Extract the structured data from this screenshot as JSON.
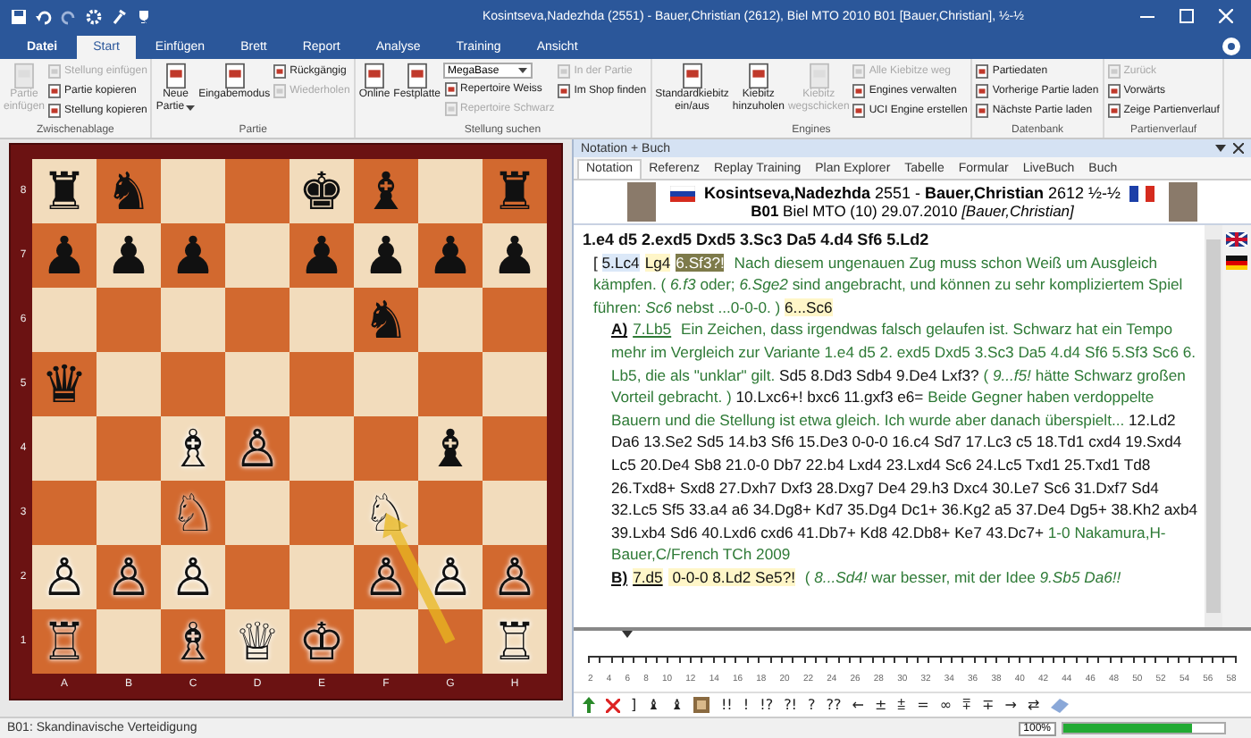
{
  "window": {
    "title": "Kosintseva,Nadezhda (2551) - Bauer,Christian (2612), Biel MTO 2010  B01  [Bauer,Christian], ½-½"
  },
  "tabs": [
    {
      "label": "Datei",
      "selected": false
    },
    {
      "label": "Start",
      "selected": true
    },
    {
      "label": "Einfügen",
      "selected": false
    },
    {
      "label": "Brett",
      "selected": false
    },
    {
      "label": "Report",
      "selected": false
    },
    {
      "label": "Analyse",
      "selected": false
    },
    {
      "label": "Training",
      "selected": false
    },
    {
      "label": "Ansicht",
      "selected": false
    }
  ],
  "ribbon": [
    {
      "label": "Zwischenablage",
      "columns": [
        {
          "kind": "large",
          "lines": [
            "Partie",
            "einfügen"
          ],
          "disabled": true
        },
        {
          "kind": "stack",
          "items": [
            {
              "label": "Stellung einfügen",
              "disabled": true
            },
            {
              "label": "Partie kopieren",
              "disabled": false
            },
            {
              "label": "Stellung kopieren",
              "disabled": false
            }
          ]
        }
      ]
    },
    {
      "label": "Partie",
      "columns": [
        {
          "kind": "large",
          "lines": [
            "Neue",
            "Partie"
          ],
          "disabled": false,
          "dropdown": true
        },
        {
          "kind": "large",
          "lines": [
            "Eingabemodus"
          ],
          "disabled": false
        },
        {
          "kind": "stack",
          "items": [
            {
              "label": "Rückgängig",
              "disabled": false
            },
            {
              "label": "Wiederholen",
              "disabled": true
            }
          ]
        }
      ]
    },
    {
      "label": "Stellung suchen",
      "columns": [
        {
          "kind": "large",
          "lines": [
            "Online"
          ],
          "disabled": false
        },
        {
          "kind": "large",
          "lines": [
            "Festplatte"
          ],
          "disabled": false
        },
        {
          "kind": "stack",
          "items": [
            {
              "label": "MegaBase",
              "disabled": false,
              "combo": true
            },
            {
              "label": "Repertoire Weiss",
              "disabled": false
            },
            {
              "label": "Repertoire Schwarz",
              "disabled": true
            }
          ]
        },
        {
          "kind": "stack",
          "items": [
            {
              "label": "In der Partie",
              "disabled": true
            },
            {
              "label": "Im Shop finden",
              "disabled": false
            }
          ]
        }
      ]
    },
    {
      "label": "Engines",
      "columns": [
        {
          "kind": "large",
          "lines": [
            "Standardkiebitz",
            "ein/aus"
          ],
          "disabled": false
        },
        {
          "kind": "large",
          "lines": [
            "Kiebitz",
            "hinzuholen"
          ],
          "disabled": false
        },
        {
          "kind": "large",
          "lines": [
            "Kiebitz",
            "wegschicken"
          ],
          "disabled": true
        },
        {
          "kind": "stack",
          "items": [
            {
              "label": "Alle Kiebitze weg",
              "disabled": true
            },
            {
              "label": "Engines verwalten",
              "disabled": false
            },
            {
              "label": "UCI Engine erstellen",
              "disabled": false
            }
          ]
        }
      ]
    },
    {
      "label": "Datenbank",
      "columns": [
        {
          "kind": "stack",
          "items": [
            {
              "label": "Partiedaten",
              "disabled": false
            },
            {
              "label": "Vorherige Partie laden",
              "disabled": false
            },
            {
              "label": "Nächste Partie laden",
              "disabled": false
            }
          ]
        }
      ]
    },
    {
      "label": "Partienverlauf",
      "columns": [
        {
          "kind": "stack",
          "items": [
            {
              "label": "Zurück",
              "disabled": true
            },
            {
              "label": "Vorwärts",
              "disabled": false
            },
            {
              "label": "Zeige Partienverlauf",
              "disabled": false
            }
          ]
        }
      ]
    }
  ],
  "board": {
    "files": [
      "A",
      "B",
      "C",
      "D",
      "E",
      "F",
      "G",
      "H"
    ],
    "ranks": [
      {
        "label": "8",
        "squares": [
          {
            "dark": false,
            "glyph": "♜",
            "white": false
          },
          {
            "dark": true,
            "glyph": "♞",
            "white": false
          },
          {
            "dark": false
          },
          {
            "dark": true
          },
          {
            "dark": false,
            "glyph": "♚",
            "white": false
          },
          {
            "dark": true,
            "glyph": "♝",
            "white": false
          },
          {
            "dark": false
          },
          {
            "dark": true,
            "glyph": "♜",
            "white": false
          }
        ]
      },
      {
        "label": "7",
        "squares": [
          {
            "dark": true,
            "glyph": "♟",
            "white": false
          },
          {
            "dark": false,
            "glyph": "♟",
            "white": false
          },
          {
            "dark": true,
            "glyph": "♟",
            "white": false
          },
          {
            "dark": false
          },
          {
            "dark": true,
            "glyph": "♟",
            "white": false
          },
          {
            "dark": false,
            "glyph": "♟",
            "white": false
          },
          {
            "dark": true,
            "glyph": "♟",
            "white": false
          },
          {
            "dark": false,
            "glyph": "♟",
            "white": false
          }
        ]
      },
      {
        "label": "6",
        "squares": [
          {
            "dark": false
          },
          {
            "dark": true
          },
          {
            "dark": false
          },
          {
            "dark": true
          },
          {
            "dark": false
          },
          {
            "dark": true,
            "glyph": "♞",
            "white": false
          },
          {
            "dark": false
          },
          {
            "dark": true
          }
        ]
      },
      {
        "label": "5",
        "squares": [
          {
            "dark": true,
            "glyph": "♛",
            "white": false
          },
          {
            "dark": false
          },
          {
            "dark": true
          },
          {
            "dark": false
          },
          {
            "dark": true
          },
          {
            "dark": false
          },
          {
            "dark": true
          },
          {
            "dark": false
          }
        ]
      },
      {
        "label": "4",
        "squares": [
          {
            "dark": false
          },
          {
            "dark": true
          },
          {
            "dark": false,
            "glyph": "♗",
            "white": true
          },
          {
            "dark": true,
            "glyph": "♙",
            "white": true
          },
          {
            "dark": false
          },
          {
            "dark": true
          },
          {
            "dark": false,
            "glyph": "♝",
            "white": false
          },
          {
            "dark": true
          }
        ]
      },
      {
        "label": "3",
        "squares": [
          {
            "dark": true
          },
          {
            "dark": false
          },
          {
            "dark": true,
            "glyph": "♘",
            "white": true
          },
          {
            "dark": false
          },
          {
            "dark": true
          },
          {
            "dark": false,
            "glyph": "♘",
            "white": true,
            "arrow_end": true
          },
          {
            "dark": true
          },
          {
            "dark": false
          }
        ]
      },
      {
        "label": "2",
        "squares": [
          {
            "dark": false,
            "glyph": "♙",
            "white": true
          },
          {
            "dark": true,
            "glyph": "♙",
            "white": true
          },
          {
            "dark": false,
            "glyph": "♙",
            "white": true
          },
          {
            "dark": true
          },
          {
            "dark": false
          },
          {
            "dark": true,
            "glyph": "♙",
            "white": true
          },
          {
            "dark": false,
            "glyph": "♙",
            "white": true
          },
          {
            "dark": true,
            "glyph": "♙",
            "white": true
          }
        ]
      },
      {
        "label": "1",
        "squares": [
          {
            "dark": true,
            "glyph": "♖",
            "white": true
          },
          {
            "dark": false
          },
          {
            "dark": true,
            "glyph": "♗",
            "white": true
          },
          {
            "dark": false,
            "glyph": "♕",
            "white": true
          },
          {
            "dark": true,
            "glyph": "♔",
            "white": true
          },
          {
            "dark": false
          },
          {
            "dark": true,
            "arrow_start": true
          },
          {
            "dark": false,
            "glyph": "♖",
            "white": true
          }
        ]
      }
    ]
  },
  "notation_panel": {
    "title": "Notation + Buch",
    "tabs": [
      {
        "label": "Notation",
        "selected": true
      },
      {
        "label": "Referenz",
        "selected": false
      },
      {
        "label": "Replay Training",
        "selected": false
      },
      {
        "label": "Plan Explorer",
        "selected": false
      },
      {
        "label": "Tabelle",
        "selected": false
      },
      {
        "label": "Formular",
        "selected": false
      },
      {
        "label": "LiveBuch",
        "selected": false
      },
      {
        "label": "Buch",
        "selected": false
      }
    ],
    "players_line": "**Kosintseva,Nadezhda** 2551 - **Bauer,Christian** 2612  ½-½",
    "event_line": "**B01** Biel MTO (10) 29.07.2010 *[Bauer,Christian]*",
    "paragraphs": [
      {
        "kind": "mainline",
        "segments": [
          {
            "kind": "move",
            "text": "1.e4  d5  2.exd5  Dxd5  3.Sc3  Da5  4.d4  Sf6  5.Ld2"
          }
        ]
      },
      {
        "kind": "variation",
        "segments": [
          {
            "kind": "move",
            "text": "[ "
          },
          {
            "kind": "first",
            "text": "5.Lc4"
          },
          {
            "kind": "mark",
            "text": "Lg4"
          },
          {
            "kind": "current",
            "text": "6.Sf3?!"
          },
          {
            "kind": "comment",
            "text": " Nach diesem ungenauen Zug muss schon Weiß um Ausgleich kämpfen.  ( *6.f3* oder; *6.Sge2* sind angebracht, und können zu sehr kompliziertem Spiel führen:  *Sc6* nebst ...0-0-0. ) "
          },
          {
            "kind": "mark",
            "text": "6...Sc6"
          }
        ]
      },
      {
        "kind": "subvariation",
        "segments": [
          {
            "kind": "label",
            "text": "A)"
          },
          {
            "kind": "line",
            "text": "7.Lb5"
          },
          {
            "kind": "comment",
            "text": " Ein Zeichen, dass irgendwas falsch gelaufen ist. Schwarz hat ein Tempo mehr im Vergleich zur Variante 1.e4 d5 2. exd5 Dxd5 3.Sc3 Da5 4.d4 Sf6 5.Sf3 Sc6 6. Lb5, die als \"unklar\" gilt. "
          },
          {
            "kind": "move",
            "text": " Sd5  8.Dd3  Sdb4  9.De4  Lxf3? "
          },
          {
            "kind": "comment",
            "text": " ( *9...f5!* hätte Schwarz großen Vorteil gebracht. ) "
          },
          {
            "kind": "move",
            "text": "10.Lxc6+!  bxc6  11.gxf3  e6="
          },
          {
            "kind": "comment",
            "text": " Beide Gegner haben verdoppelte Bauern und die Stellung ist etwa gleich. Ich wurde aber danach überspielt... "
          },
          {
            "kind": "move",
            "text": " 12.Ld2  Da6  13.Se2  Sd5  14.b3  Sf6  15.De3  0-0-0  16.c4  Sd7  17.Lc3 c5  18.Td1  cxd4  19.Sxd4  Lc5  20.De4  Sb8  21.0-0  Db7  22.b4  Lxd4  23.Lxd4  Sc6 24.Lc5  Txd1  25.Txd1  Td8  26.Txd8+  Sxd8  27.Dxh7  Dxf3  28.Dxg7  De4  29.h3 Dxc4  30.Le7  Sc6  31.Dxf7  Sd4  32.Lc5  Sf5  33.a4  a6  34.Dg8+  Kd7  35.Dg4  Dc1+ 36.Kg2  a5  37.De4  Dg5+  38.Kh2  axb4  39.Lxb4  Sd6  40.Lxd6  cxd6  41.Db7+  Kd8 42.Db8+  Ke7  43.Dc7+"
          },
          {
            "kind": "comment",
            "text": " 1-0 Nakamura,H-Bauer,C/French TCh 2009"
          }
        ]
      },
      {
        "kind": "subvariation",
        "segments": [
          {
            "kind": "label",
            "text": "B)"
          },
          {
            "kind": "markline",
            "text": "7.d5"
          },
          {
            "kind": "mark",
            "text": "  0-0-0  8.Ld2  Se5?!"
          },
          {
            "kind": "comment",
            "text": "  ( *8...Sd4!* war besser, mit der Idee  *9.Sb5  Da6!!*"
          }
        ]
      }
    ],
    "timeline": {
      "level": 0.07,
      "labels": [
        "2",
        "4",
        "6",
        "8",
        "10",
        "12",
        "14",
        "16",
        "18",
        "20",
        "22",
        "24",
        "26",
        "28",
        "30",
        "32",
        "34",
        "36",
        "38",
        "40",
        "42",
        "44",
        "46",
        "48",
        "50",
        "52",
        "54",
        "56",
        "58"
      ]
    },
    "symbols": [
      {
        "kind": "arrow"
      },
      {
        "kind": "cross"
      },
      {
        "kind": "text",
        "text": "]"
      },
      {
        "kind": "text",
        "text": "♝"
      },
      {
        "kind": "text",
        "text": "♝"
      },
      {
        "kind": "picture"
      },
      {
        "kind": "text",
        "text": "!!"
      },
      {
        "kind": "text",
        "text": "!"
      },
      {
        "kind": "text",
        "text": "!?"
      },
      {
        "kind": "text",
        "text": "?!"
      },
      {
        "kind": "text",
        "text": "?"
      },
      {
        "kind": "text",
        "text": "??"
      },
      {
        "kind": "text",
        "text": "←"
      },
      {
        "kind": "text",
        "text": "±"
      },
      {
        "kind": "text",
        "text": "⩲"
      },
      {
        "kind": "text",
        "text": "="
      },
      {
        "kind": "text",
        "text": "∞"
      },
      {
        "kind": "text",
        "text": "⩱"
      },
      {
        "kind": "text",
        "text": "∓"
      },
      {
        "kind": "text",
        "text": "→"
      },
      {
        "kind": "text",
        "text": "⇄"
      },
      {
        "kind": "eraser"
      }
    ]
  },
  "status_bar": {
    "text": "B01: Skandinavische Verteidigung",
    "zoom": "100%",
    "level": 0.8
  }
}
